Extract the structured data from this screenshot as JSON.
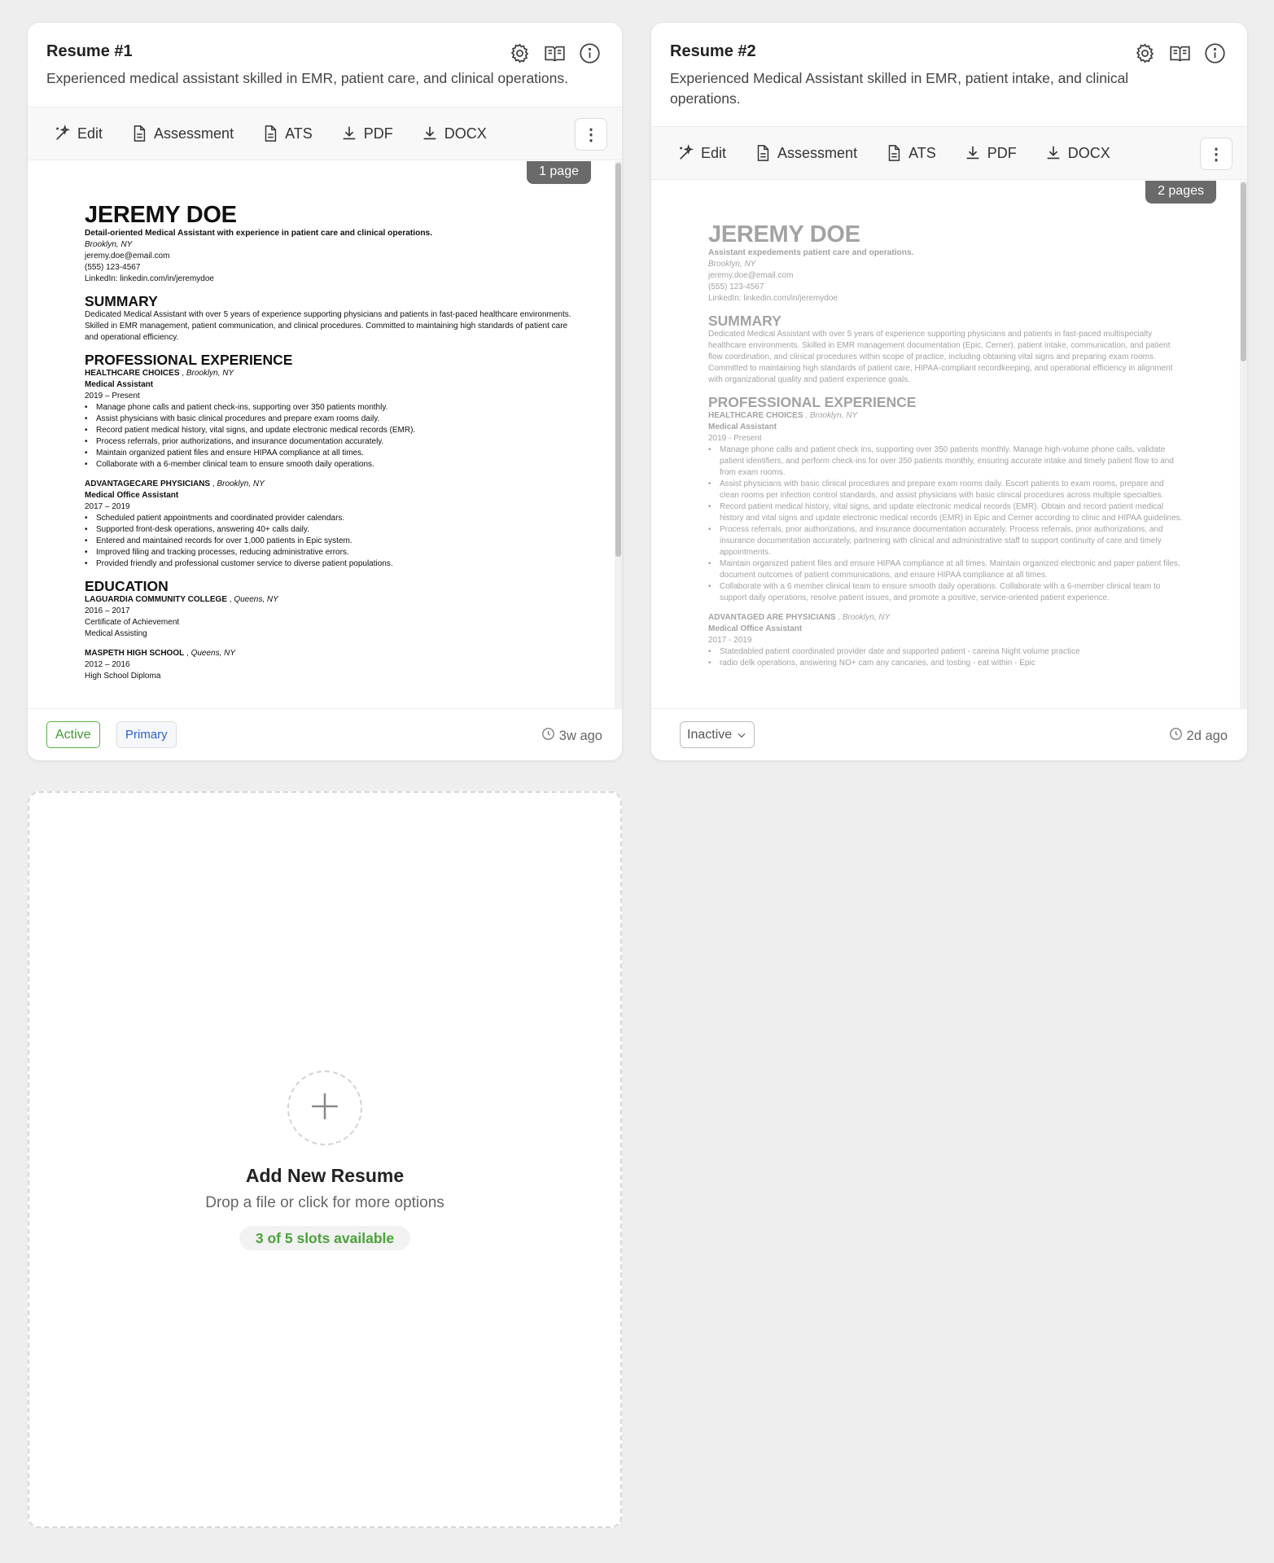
{
  "resumes": [
    {
      "title": "Resume #1",
      "description": "Experienced medical assistant skilled in EMR, patient care, and clinical operations.",
      "pages": "1 page",
      "status": "Active",
      "primary": "Primary",
      "time": "3w ago",
      "doc": {
        "name": "JEREMY DOE",
        "tagline": "Detail-oriented Medical Assistant with experience in patient care and clinical operations.",
        "location": "Brooklyn, NY",
        "email": "jeremy.doe@email.com",
        "phone": "(555) 123-4567",
        "linkedin": "LinkedIn: linkedin.com/in/jeremydoe",
        "summary_heading": "SUMMARY",
        "summary": "Dedicated Medical Assistant with over 5 years of experience supporting physicians and patients in fast-paced healthcare environments. Skilled in EMR management, patient communication, and clinical procedures. Committed to maintaining high standards of patient care and operational efficiency.",
        "experience_heading": "PROFESSIONAL EXPERIENCE",
        "jobs": [
          {
            "employer": "HEALTHCARE CHOICES",
            "location": "Brooklyn, NY",
            "role": "Medical Assistant",
            "dates": "2019 – Present",
            "bullets": [
              "Manage phone calls and patient check-ins, supporting over 350 patients monthly.",
              "Assist physicians with basic clinical procedures and prepare exam rooms daily.",
              "Record patient medical history, vital signs, and update electronic medical records (EMR).",
              "Process referrals, prior authorizations, and insurance documentation accurately.",
              "Maintain organized patient files and ensure HIPAA compliance at all times.",
              "Collaborate with a 6-member clinical team to ensure smooth daily operations."
            ]
          },
          {
            "employer": "ADVANTAGECARE PHYSICIANS",
            "location": "Brooklyn, NY",
            "role": "Medical Office Assistant",
            "dates": "2017 – 2019",
            "bullets": [
              "Scheduled patient appointments and coordinated provider calendars.",
              "Supported front-desk operations, answering 40+ calls daily.",
              "Entered and maintained records for over 1,000 patients in Epic system.",
              "Improved filing and tracking processes, reducing administrative errors.",
              "Provided friendly and professional customer service to diverse patient populations."
            ]
          }
        ],
        "education_heading": "EDUCATION",
        "schools": [
          {
            "school": "LAGUARDIA COMMUNITY COLLEGE",
            "location": "Queens, NY",
            "dates": "2016 – 2017",
            "line1": "Certificate of Achievement",
            "line2": "Medical Assisting"
          },
          {
            "school": "MASPETH HIGH SCHOOL",
            "location": "Queens, NY",
            "dates": "2012 – 2016",
            "line1": "High School Diploma"
          }
        ]
      }
    },
    {
      "title": "Resume #2",
      "description": "Experienced Medical Assistant skilled in EMR, patient intake, and clinical operations.",
      "pages": "2 pages",
      "status": "Inactive",
      "time": "2d ago",
      "doc": {
        "name": "JEREMY DOE",
        "tagline": "Assistant expedements patient care and operations.",
        "location": "Brooklyn, NY",
        "email": "jeremy.doe@email.com",
        "phone": "(555) 123-4567",
        "linkedin": "LinkedIn: linkedin.com/in/jeremydoe",
        "summary_heading": "SUMMARY",
        "summary": "Dedicated Medical Assistant with over 5 years of experience supporting physicians and patients in fast-paced multispecialty healthcare environments. Skilled in EMR management documentation (Epic, Cerner), patient intake, communication, and patient flow coordination, and clinical procedures within scope of practice, including obtaining vital signs and preparing exam rooms. Committed to maintaining high standards of patient care, HIPAA-compliant recordkeeping, and operational efficiency in alignment with organizational quality and patient experience goals.",
        "experience_heading": "PROFESSIONAL EXPERIENCE",
        "jobs": [
          {
            "employer": "HEALTHCARE CHOICES",
            "location": "Brooklyn, NY",
            "role": "Medical Assistant",
            "dates": "2019 - Present",
            "bullets": [
              "Manage phone calls and patient check ins, supporting over 350 patients monthly. Manage high-volume phone calls, validate patient identifiers, and perform check-ins for over 350 patients monthly, ensuring accurate intake and timely patient flow to and from exam rooms.",
              "Assist physicians with basic clinical procedures and prepare exam rooms daily. Escort patients to exam rooms, prepare and clean rooms per infection control standards, and assist physicians with basic clinical procedures across multiple specialties.",
              "Record patient medical history, vital signs, and update electronic medical records (EMR). Obtain and record patient medical history and vital signs and update electronic medical records (EMR) in Epic and Cerner according to clinic and HIPAA guidelines.",
              "Process referrals, prior authorizations, and insurance documentation accurately. Process referrals, prior authorizations, and insurance documentation accurately, partnering with clinical and administrative staff to support continuity of care and timely appointments.",
              "Maintain organized patient files and ensure HIPAA compliance at all times. Maintain organized electronic and paper patient files, document outcomes of patient communications, and ensure HIPAA compliance at all times.",
              "Collaborate with a 6 member clinical team to ensure smooth daily operations. Collaborate with a 6-member clinical team to support daily operations, resolve patient issues, and promote a positive, service-oriented patient experience."
            ]
          },
          {
            "employer": "ADVANTAGED ARE PHYSICIANS",
            "location": "Brooklyn, NY",
            "role": "Medical Office Assistant",
            "dates": "2017 - 2019",
            "bullets": [
              "Statedabled patient coordinated provider date and supported patient - careina Night volume practice",
              "radio delk operations, answering NO+ cam any cancaries, and tosting - eat within - Epic"
            ]
          }
        ]
      }
    }
  ],
  "toolbar": {
    "edit": "Edit",
    "assessment": "Assessment",
    "ats": "ATS",
    "pdf": "PDF",
    "docx": "DOCX",
    "more": "⋮"
  },
  "add_resume": {
    "title": "Add New Resume",
    "subtitle": "Drop a file or click for more options",
    "slots": "3 of 5 slots available"
  },
  "colors": {
    "background": "#eeeeee",
    "active_green": "#3f9a2f",
    "primary_blue": "#2a63c8",
    "badge_gray": "#6a6a6a"
  },
  "icons": [
    "settings-icon",
    "book-icon",
    "info-icon",
    "magic-wand-icon",
    "document-icon",
    "download-icon",
    "clock-icon",
    "plus-icon",
    "chevron-down-icon"
  ]
}
